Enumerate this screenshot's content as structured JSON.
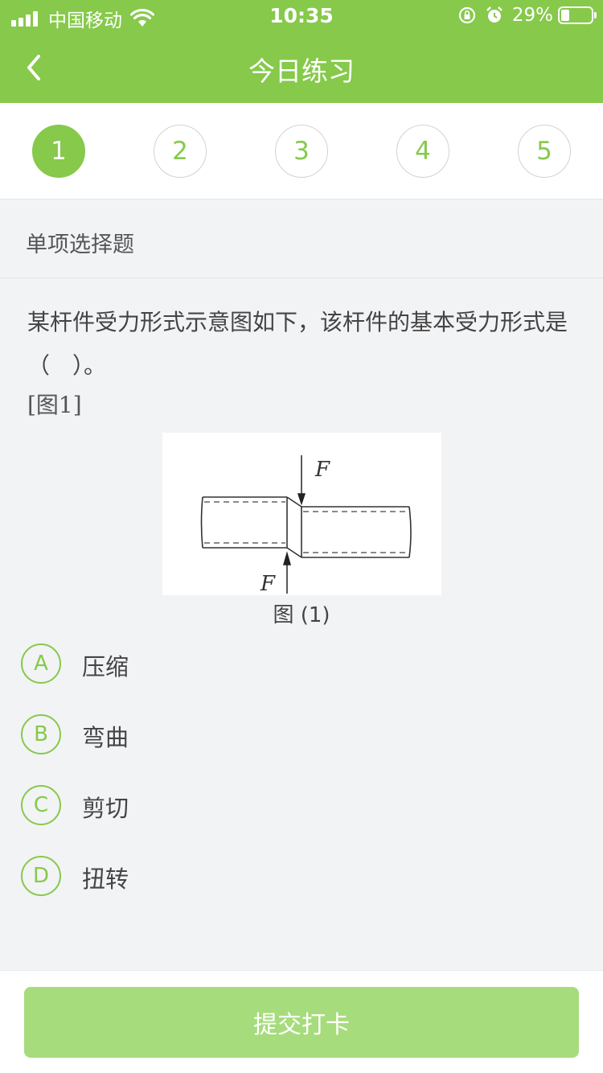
{
  "status_bar": {
    "carrier": "中国移动",
    "time": "10:35",
    "battery_percent": "29%",
    "battery_level": 0.29,
    "icons": [
      "signal-icon",
      "wifi-icon",
      "orientation-lock-icon",
      "alarm-icon",
      "battery-icon"
    ]
  },
  "nav": {
    "title": "今日练习",
    "back_icon": "chevron-left-icon"
  },
  "question_numbers": [
    "1",
    "2",
    "3",
    "4",
    "5"
  ],
  "active_question": "1",
  "question_type": "单项选择题",
  "question": {
    "text": "某杆件受力形式示意图如下，该杆件的基本受力形式是（　）。",
    "figure_ref": "[图1]",
    "figure_labels": {
      "top_force": "F",
      "bottom_force": "F"
    },
    "figure_caption": "图 (1)"
  },
  "options": [
    {
      "letter": "A",
      "text": "压缩"
    },
    {
      "letter": "B",
      "text": "弯曲"
    },
    {
      "letter": "C",
      "text": "剪切"
    },
    {
      "letter": "D",
      "text": "扭转"
    }
  ],
  "submit_label": "提交打卡",
  "colors": {
    "brand_green": "#86c94b",
    "button_green_disabled": "#a6dc7c",
    "background": "#f2f3f5"
  }
}
